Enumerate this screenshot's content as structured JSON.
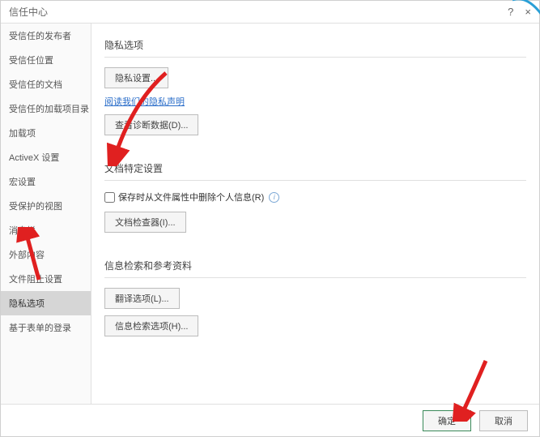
{
  "titlebar": {
    "title": "信任中心",
    "help": "?",
    "close": "×"
  },
  "sidebar": {
    "items": [
      {
        "label": "受信任的发布者"
      },
      {
        "label": "受信任位置"
      },
      {
        "label": "受信任的文档"
      },
      {
        "label": "受信任的加载项目录"
      },
      {
        "label": "加载项"
      },
      {
        "label": "ActiveX 设置"
      },
      {
        "label": "宏设置"
      },
      {
        "label": "受保护的视图"
      },
      {
        "label": "消息栏"
      },
      {
        "label": "外部内容"
      },
      {
        "label": "文件阻止设置"
      },
      {
        "label": "隐私选项"
      },
      {
        "label": "基于表单的登录"
      }
    ],
    "selectedIndex": 11
  },
  "content": {
    "section1": {
      "header": "隐私选项",
      "btn_privacy_settings": "隐私设置...",
      "link_privacy_statement": "阅读我们的隐私声明",
      "btn_diagnostic": "查看诊断数据(D)..."
    },
    "section2": {
      "header": "文档特定设置",
      "checkbox_remove_personal": "保存时从文件属性中删除个人信息(R)",
      "btn_doc_inspector": "文档检查器(I)..."
    },
    "section3": {
      "header": "信息检索和参考资料",
      "btn_translation": "翻译选项(L)...",
      "btn_research": "信息检索选项(H)..."
    }
  },
  "footer": {
    "ok": "确定",
    "cancel": "取消"
  }
}
